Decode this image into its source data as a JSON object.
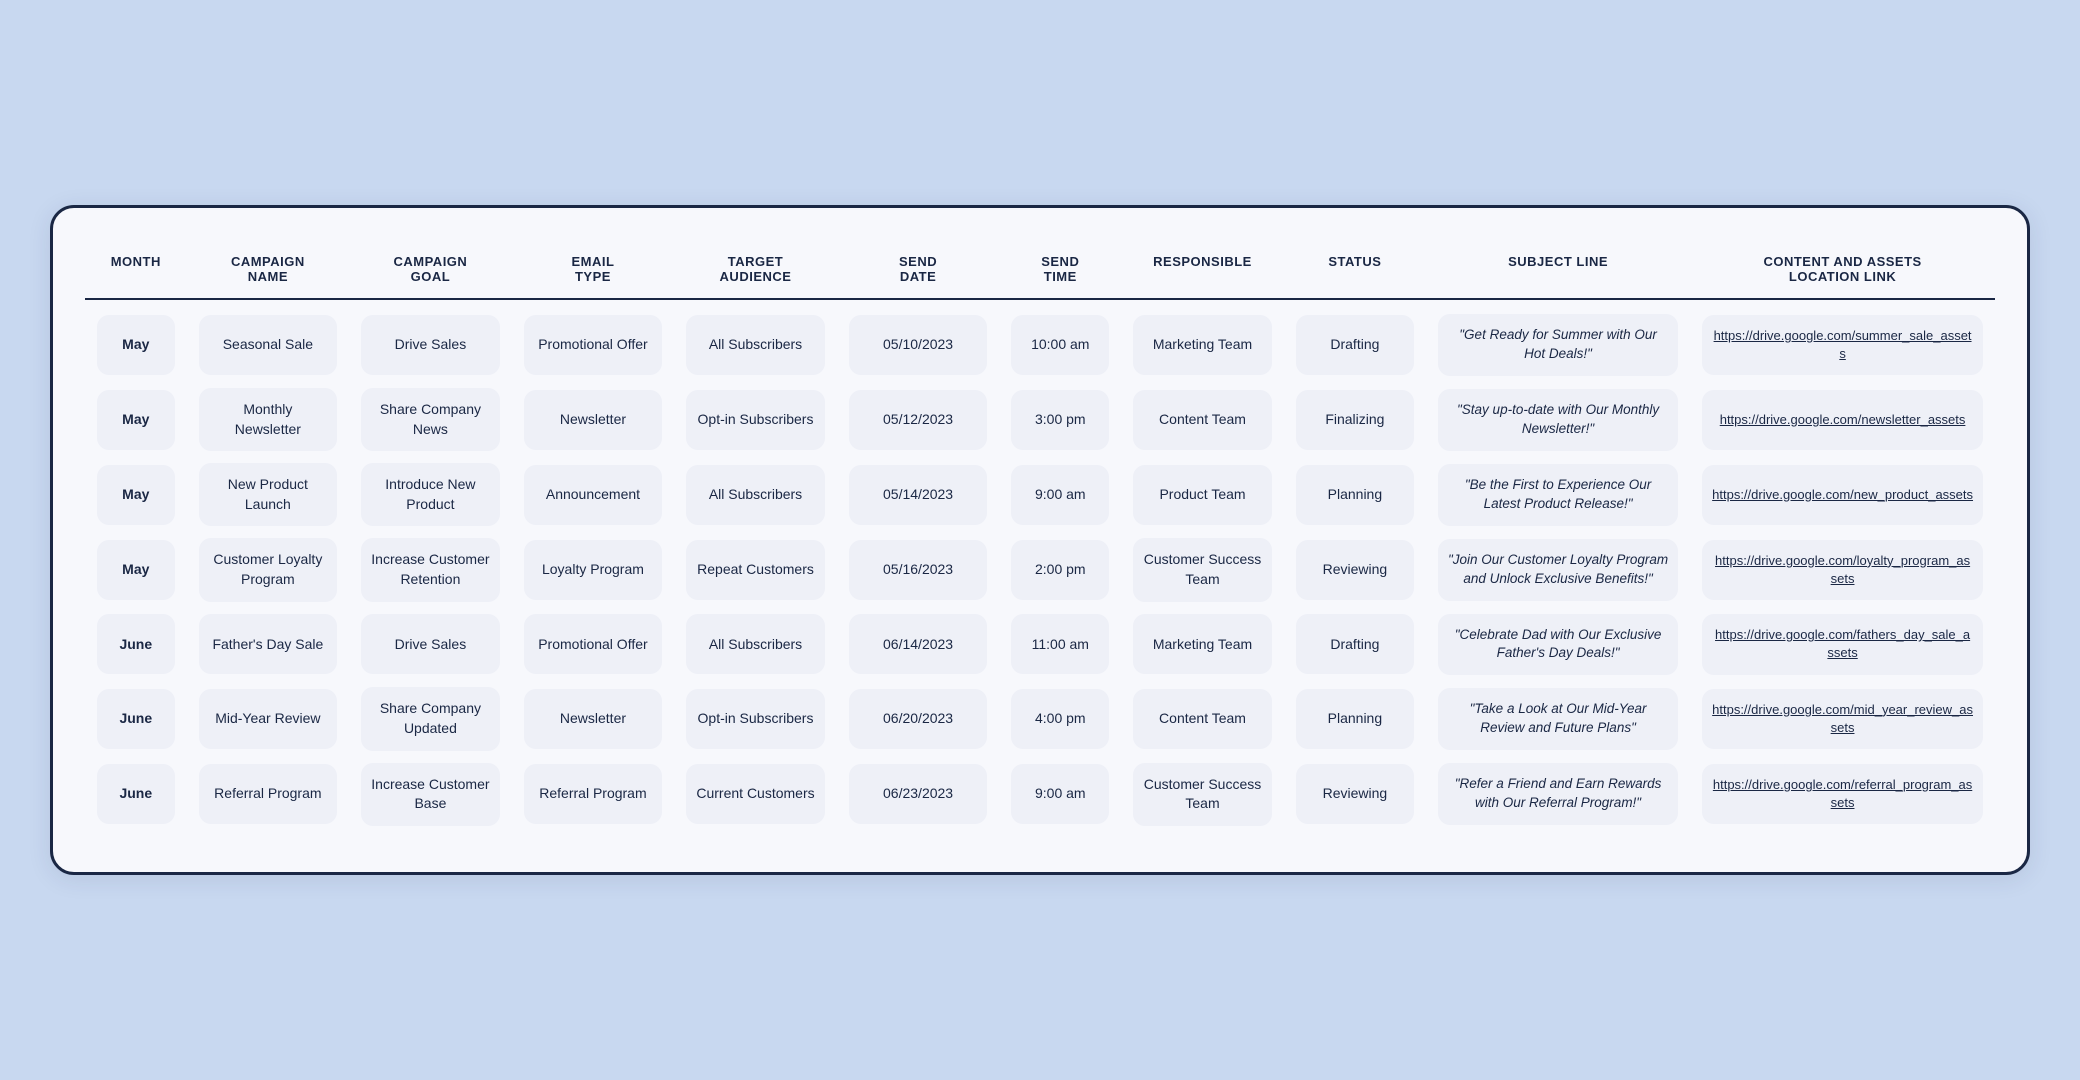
{
  "table": {
    "headers": [
      {
        "id": "month",
        "label": "MONTH"
      },
      {
        "id": "campaign-name",
        "label": "CAMPAIGN\nNAME"
      },
      {
        "id": "campaign-goal",
        "label": "CAMPAIGN\nGOAL"
      },
      {
        "id": "email-type",
        "label": "EMAIL\nTYPE"
      },
      {
        "id": "target-audience",
        "label": "TARGET\nAUDIENCE"
      },
      {
        "id": "send-date",
        "label": "SEND\nDATE"
      },
      {
        "id": "send-time",
        "label": "SEND\nTIME"
      },
      {
        "id": "responsible",
        "label": "RESPONSIBLE"
      },
      {
        "id": "status",
        "label": "STATUS"
      },
      {
        "id": "subject-line",
        "label": "SUBJECT LINE"
      },
      {
        "id": "content-link",
        "label": "CONTENT AND ASSETS\nLOCATION LINK"
      }
    ],
    "rows": [
      {
        "month": "May",
        "campaign_name": "Seasonal Sale",
        "campaign_goal": "Drive Sales",
        "email_type": "Promotional Offer",
        "target_audience": "All Subscribers",
        "send_date": "05/10/2023",
        "send_time": "10:00 am",
        "responsible": "Marketing Team",
        "status": "Drafting",
        "subject_line": "\"Get Ready for Summer with Our Hot Deals!\"",
        "content_link": "https://drive.google.com/summer_sale_assets"
      },
      {
        "month": "May",
        "campaign_name": "Monthly Newsletter",
        "campaign_goal": "Share Company News",
        "email_type": "Newsletter",
        "target_audience": "Opt-in Subscribers",
        "send_date": "05/12/2023",
        "send_time": "3:00 pm",
        "responsible": "Content Team",
        "status": "Finalizing",
        "subject_line": "\"Stay up-to-date with Our Monthly Newsletter!\"",
        "content_link": "https://drive.google.com/newsletter_assets"
      },
      {
        "month": "May",
        "campaign_name": "New Product Launch",
        "campaign_goal": "Introduce New Product",
        "email_type": "Announcement",
        "target_audience": "All Subscribers",
        "send_date": "05/14/2023",
        "send_time": "9:00 am",
        "responsible": "Product Team",
        "status": "Planning",
        "subject_line": "\"Be the First to Experience Our Latest Product Release!\"",
        "content_link": "https://drive.google.com/new_product_assets"
      },
      {
        "month": "May",
        "campaign_name": "Customer Loyalty Program",
        "campaign_goal": "Increase Customer Retention",
        "email_type": "Loyalty Program",
        "target_audience": "Repeat Customers",
        "send_date": "05/16/2023",
        "send_time": "2:00 pm",
        "responsible": "Customer Success Team",
        "status": "Reviewing",
        "subject_line": "\"Join Our Customer Loyalty Program and Unlock Exclusive Benefits!\"",
        "content_link": "https://drive.google.com/loyalty_program_assets"
      },
      {
        "month": "June",
        "campaign_name": "Father's Day Sale",
        "campaign_goal": "Drive Sales",
        "email_type": "Promotional Offer",
        "target_audience": "All Subscribers",
        "send_date": "06/14/2023",
        "send_time": "11:00 am",
        "responsible": "Marketing Team",
        "status": "Drafting",
        "subject_line": "\"Celebrate Dad with Our Exclusive Father's Day Deals!\"",
        "content_link": "https://drive.google.com/fathers_day_sale_assets"
      },
      {
        "month": "June",
        "campaign_name": "Mid-Year Review",
        "campaign_goal": "Share Company Updated",
        "email_type": "Newsletter",
        "target_audience": "Opt-in Subscribers",
        "send_date": "06/20/2023",
        "send_time": "4:00 pm",
        "responsible": "Content Team",
        "status": "Planning",
        "subject_line": "\"Take a Look at Our Mid-Year Review and Future Plans\"",
        "content_link": "https://drive.google.com/mid_year_review_assets"
      },
      {
        "month": "June",
        "campaign_name": "Referral Program",
        "campaign_goal": "Increase Customer Base",
        "email_type": "Referral Program",
        "target_audience": "Current Customers",
        "send_date": "06/23/2023",
        "send_time": "9:00 am",
        "responsible": "Customer Success Team",
        "status": "Reviewing",
        "subject_line": "\"Refer a Friend and Earn Rewards with Our Referral Program!\"",
        "content_link": "https://drive.google.com/referral_program_assets"
      }
    ]
  }
}
